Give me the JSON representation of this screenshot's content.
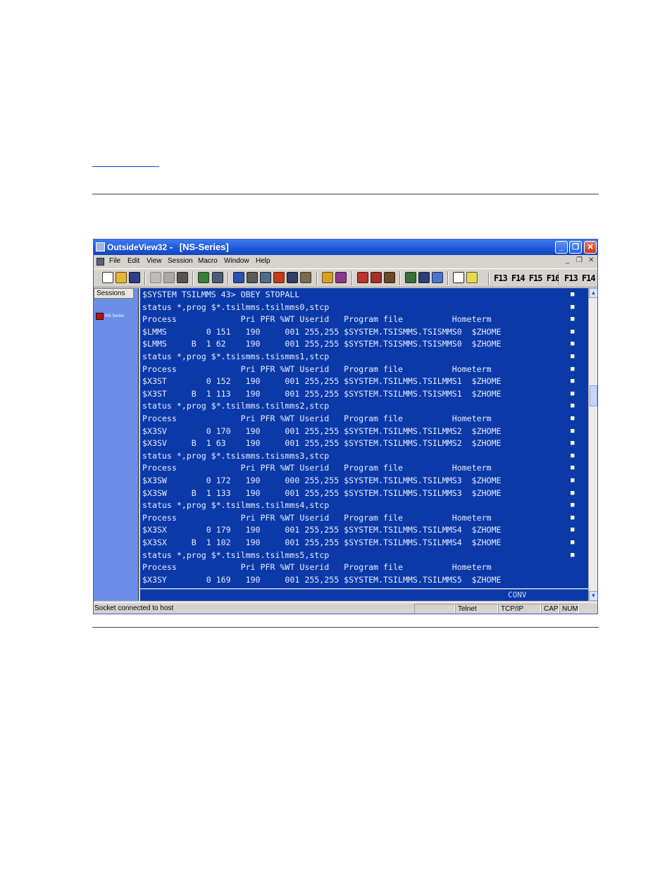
{
  "window": {
    "app_title": "OutsideView32",
    "separator": "-",
    "doc_title": "[NS-Series]",
    "min_glyph": "_",
    "max_glyph": "❐",
    "close_glyph": "✕"
  },
  "menu": {
    "items": [
      "File",
      "Edit",
      "View",
      "Session",
      "Macro",
      "Window",
      "Help"
    ],
    "mdi_min": "_",
    "mdi_restore": "❐",
    "mdi_close": "✕"
  },
  "toolbar": {
    "function_keys": "F13 F14 F15 F16",
    "function_keys_right": "F13 F14"
  },
  "sidebar": {
    "header": "Sessions",
    "session_label": "NS-Series"
  },
  "terminal": {
    "lines": [
      "$SYSTEM TSILMMS 43> OBEY STOPALL",
      "status *,prog $*.tsilmms.tsilmms0,stcp",
      "Process             Pri PFR %WT Userid   Program file          Hometerm",
      "$LMMS        0 151   190     001 255,255 $SYSTEM.TSISMMS.TSISMMS0  $ZHOME",
      "$LMMS     B  1 62    190     001 255,255 $SYSTEM.TSISMMS.TSISMMS0  $ZHOME",
      "status *,prog $*.tsismms.tsismms1,stcp",
      "Process             Pri PFR %WT Userid   Program file          Hometerm",
      "$X3ST        0 152   190     001 255,255 $SYSTEM.TSILMMS.TSILMMS1  $ZHOME",
      "$X3ST     B  1 113   190     001 255,255 $SYSTEM.TSILMMS.TSISMMS1  $ZHOME",
      "status *,prog $*.tsilmms.tsilmms2,stcp",
      "Process             Pri PFR %WT Userid   Program file          Hometerm",
      "$X3SV        0 170   190     001 255,255 $SYSTEM.TSILMMS.TSILMMS2  $ZHOME",
      "$X3SV     B  1 63    190     001 255,255 $SYSTEM.TSILMMS.TSILMMS2  $ZHOME",
      "status *,prog $*.tsismms.tsismms3,stcp",
      "Process             Pri PFR %WT Userid   Program file          Hometerm",
      "$X3SW        0 172   190     000 255,255 $SYSTEM.TSILMMS.TSILMMS3  $ZHOME",
      "$X3SW     B  1 133   190     001 255,255 $SYSTEM.TSILMMS.TSILMMS3  $ZHOME",
      "status *,prog $*.tsilmms.tsilmms4,stcp",
      "Process             Pri PFR %WT Userid   Program file          Hometerm",
      "$X3SX        0 179   190     001 255,255 $SYSTEM.TSILMMS.TSILMMS4  $ZHOME",
      "$X3SX     B  1 102   190     001 255,255 $SYSTEM.TSILMMS.TSILMMS4  $ZHOME",
      "status *,prog $*.tsilmms.tsilmms5,stcp",
      "Process             Pri PFR %WT Userid   Program file          Hometerm",
      "$X3SY        0 169   190     001 255,255 $SYSTEM.TSILMMS.TSILMMS5  $ZHOME"
    ],
    "mode": "CONV",
    "bg_color": "#0b3aa8"
  },
  "status_bar": {
    "message": "Socket connected to host",
    "protocol": "Telnet",
    "transport": "TCP/IP",
    "caps": "CAP",
    "num": "NUM"
  }
}
